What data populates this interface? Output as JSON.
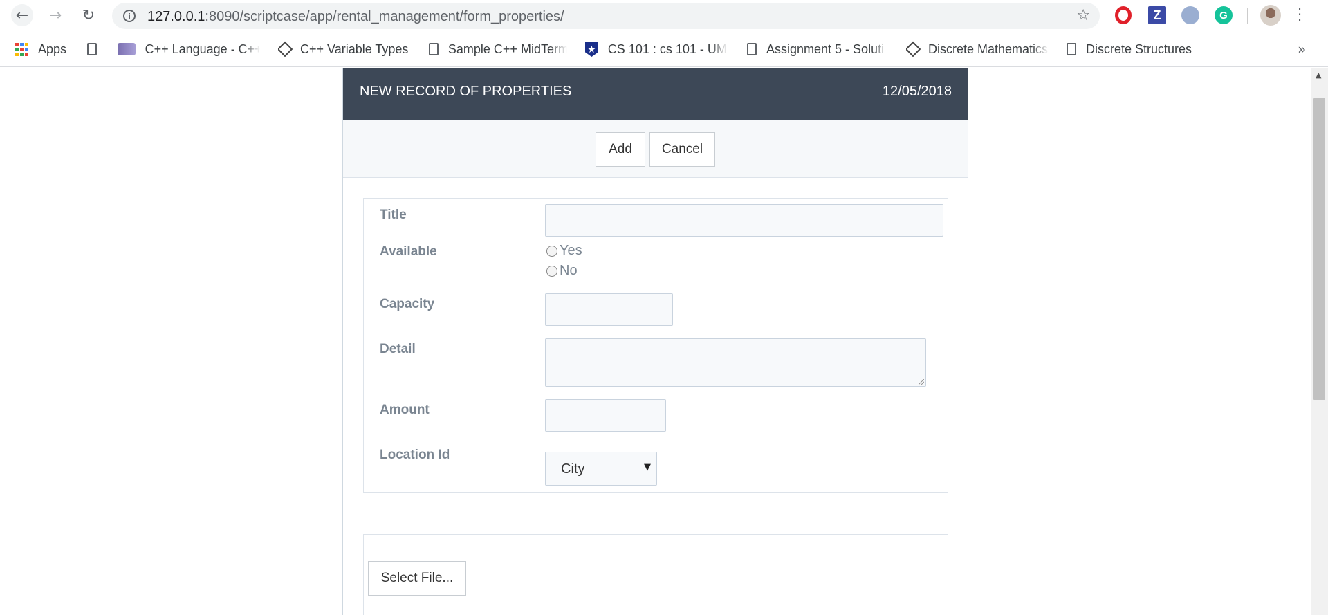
{
  "browser": {
    "url_host": "127.0.0.1",
    "url_path": ":8090/scriptcase/app/rental_management/form_properties/",
    "bookmarks": [
      {
        "label": "Apps"
      },
      {
        "label": ""
      },
      {
        "label": "C++ Language - C++"
      },
      {
        "label": "C++ Variable Types"
      },
      {
        "label": "Sample C++ MidTerm"
      },
      {
        "label": "CS 101 : cs 101 - UMK"
      },
      {
        "label": "Assignment 5 - Soluti"
      },
      {
        "label": "Discrete Mathematics"
      },
      {
        "label": "Discrete Structures"
      }
    ],
    "ext_z": "Z"
  },
  "form": {
    "title": "NEW RECORD OF PROPERTIES",
    "date": "12/05/2018",
    "add_label": "Add",
    "cancel_label": "Cancel",
    "fields": {
      "title_label": "Title",
      "available_label": "Available",
      "available_options": [
        "Yes",
        "No"
      ],
      "capacity_label": "Capacity",
      "detail_label": "Detail",
      "amount_label": "Amount",
      "location_label": "Location Id",
      "location_value": "City"
    },
    "select_file_label": "Select File..."
  }
}
